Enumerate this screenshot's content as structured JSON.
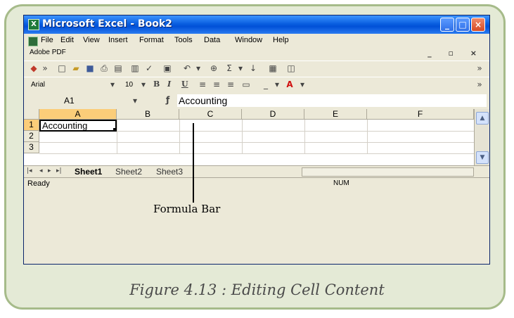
{
  "window": {
    "title": "Microsoft Excel - Book2",
    "controls": [
      "minimize",
      "maximize",
      "close"
    ]
  },
  "menubar": {
    "items": [
      "File",
      "Edit",
      "View",
      "Insert",
      "Format",
      "Tools",
      "Data",
      "Window",
      "Help"
    ],
    "adobe_label": "Adobe PDF",
    "mdi_controls": "_ ▫ ×"
  },
  "formatting": {
    "font_name": "Arial",
    "font_size": "10"
  },
  "formula_bar": {
    "name_box": "A1",
    "fx_symbol": "fx",
    "content": "Accounting"
  },
  "grid": {
    "columns": [
      "A",
      "B",
      "C",
      "D",
      "E",
      "F"
    ],
    "rows": [
      "1",
      "2",
      "3"
    ],
    "active_cell_value": "Accounting"
  },
  "sheets": {
    "tabs": [
      "Sheet1",
      "Sheet2",
      "Sheet3"
    ],
    "active": "Sheet1"
  },
  "status": {
    "left": "Ready",
    "num": "NUM"
  },
  "annotation": {
    "label": "Formula Bar"
  },
  "caption": "Figure 4.13 : Editing Cell Content"
}
